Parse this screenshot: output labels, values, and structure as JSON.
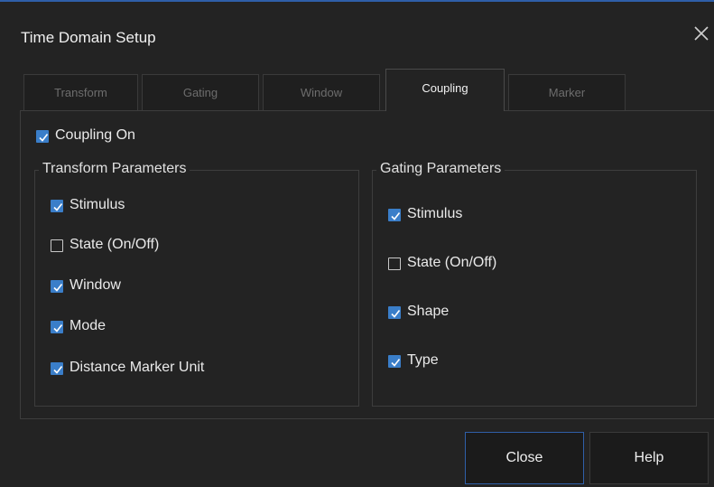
{
  "dialog": {
    "title": "Time Domain Setup",
    "close_icon": "close-icon"
  },
  "tabs": [
    {
      "label": "Transform",
      "active": false
    },
    {
      "label": "Gating",
      "active": false
    },
    {
      "label": "Window",
      "active": false
    },
    {
      "label": "Coupling",
      "active": true
    },
    {
      "label": "Marker",
      "active": false
    }
  ],
  "coupling": {
    "coupling_on": {
      "label": "Coupling On",
      "checked": true
    },
    "transform_group": {
      "title": "Transform Parameters",
      "items": [
        {
          "label": "Stimulus",
          "checked": true
        },
        {
          "label": "State (On/Off)",
          "checked": false
        },
        {
          "label": "Window",
          "checked": true
        },
        {
          "label": "Mode",
          "checked": true
        },
        {
          "label": "Distance Marker Unit",
          "checked": true
        }
      ]
    },
    "gating_group": {
      "title": "Gating Parameters",
      "items": [
        {
          "label": "Stimulus",
          "checked": true
        },
        {
          "label": "State (On/Off)",
          "checked": false
        },
        {
          "label": "Shape",
          "checked": true
        },
        {
          "label": "Type",
          "checked": true
        }
      ]
    }
  },
  "buttons": {
    "close_label": "Close",
    "help_label": "Help"
  },
  "colors": {
    "accent": "#3a7ec9",
    "background": "#232323",
    "border": "#3d3d3d"
  }
}
